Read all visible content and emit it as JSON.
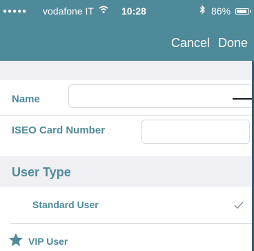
{
  "status_bar": {
    "signal_dots": "●●●●●",
    "carrier": "vodafone IT",
    "wifi_icon": "wifi-icon",
    "time": "10:28",
    "bluetooth_icon": "bluetooth-icon",
    "battery_percent": "86%",
    "battery_level": 0.86
  },
  "nav": {
    "cancel_label": "Cancel",
    "done_label": "Done"
  },
  "form": {
    "name_label": "Name",
    "name_value": "",
    "card_label": "ISEO Card Number",
    "card_value": ""
  },
  "user_type": {
    "section_title": "User Type",
    "options": [
      {
        "label": "Standard User",
        "selected": true,
        "icon": "checkmark-icon"
      },
      {
        "label": "VIP User",
        "selected": false,
        "icon": "star-icon"
      }
    ]
  },
  "colors": {
    "accent": "#4f8a9a",
    "background_gray": "#efeff4"
  }
}
